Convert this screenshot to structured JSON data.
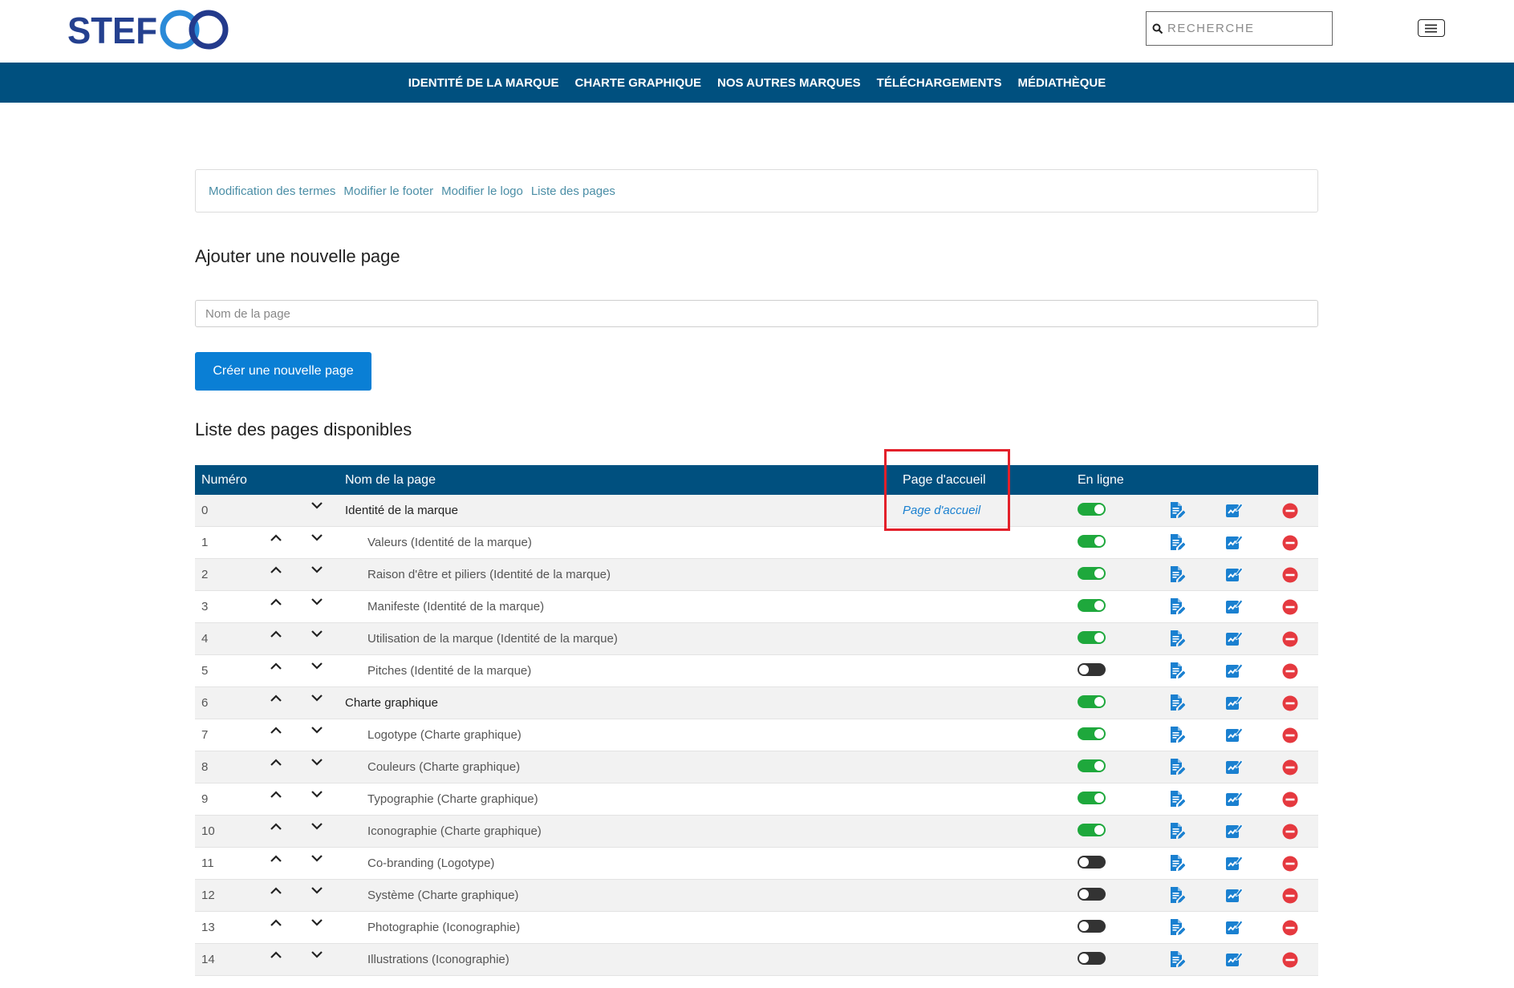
{
  "header": {
    "logo_text": "STEF",
    "search_placeholder": "RECHERCHE",
    "search_value": ""
  },
  "nav": {
    "items": [
      "IDENTITÉ DE LA MARQUE",
      "CHARTE GRAPHIQUE",
      "NOS AUTRES MARQUES",
      "TÉLÉCHARGEMENTS",
      "MÉDIATHÈQUE"
    ]
  },
  "admin_links": [
    "Modification des termes",
    "Modifier le footer",
    "Modifier le logo",
    "Liste des pages"
  ],
  "new_page": {
    "title": "Ajouter une nouvelle page",
    "name_placeholder": "Nom de la page",
    "name_value": "",
    "create_button_label": "Créer une nouvelle page"
  },
  "pages_list": {
    "title": "Liste des pages disponibles",
    "columns": {
      "number": "Numéro",
      "name": "Nom de la page",
      "homepage": "Page d'accueil",
      "online": "En ligne"
    },
    "rows": [
      {
        "number": "0",
        "name": "Identité de la marque",
        "depth": 0,
        "homepage_label": "Page d'accueil",
        "online": true,
        "can_move_up": false,
        "can_move_down": true
      },
      {
        "number": "1",
        "name": "Valeurs (Identité de la marque)",
        "depth": 1,
        "online": true,
        "can_move_up": true,
        "can_move_down": true
      },
      {
        "number": "2",
        "name": "Raison d'être et piliers (Identité de la marque)",
        "depth": 1,
        "online": true,
        "can_move_up": true,
        "can_move_down": true
      },
      {
        "number": "3",
        "name": "Manifeste (Identité de la marque)",
        "depth": 1,
        "online": true,
        "can_move_up": true,
        "can_move_down": true
      },
      {
        "number": "4",
        "name": "Utilisation de la marque (Identité de la marque)",
        "depth": 1,
        "online": true,
        "can_move_up": true,
        "can_move_down": true
      },
      {
        "number": "5",
        "name": "Pitches (Identité de la marque)",
        "depth": 1,
        "online": false,
        "can_move_up": true,
        "can_move_down": true
      },
      {
        "number": "6",
        "name": "Charte graphique",
        "depth": 0,
        "online": true,
        "can_move_up": true,
        "can_move_down": true
      },
      {
        "number": "7",
        "name": "Logotype (Charte graphique)",
        "depth": 1,
        "online": true,
        "can_move_up": true,
        "can_move_down": true
      },
      {
        "number": "8",
        "name": "Couleurs (Charte graphique)",
        "depth": 1,
        "online": true,
        "can_move_up": true,
        "can_move_down": true
      },
      {
        "number": "9",
        "name": "Typographie (Charte graphique)",
        "depth": 1,
        "online": true,
        "can_move_up": true,
        "can_move_down": true
      },
      {
        "number": "10",
        "name": "Iconographie (Charte graphique)",
        "depth": 1,
        "online": true,
        "can_move_up": true,
        "can_move_down": true
      },
      {
        "number": "11",
        "name": "Co-branding (Logotype)",
        "depth": 1,
        "online": false,
        "can_move_up": true,
        "can_move_down": true
      },
      {
        "number": "12",
        "name": "Système (Charte graphique)",
        "depth": 1,
        "online": false,
        "can_move_up": true,
        "can_move_down": true
      },
      {
        "number": "13",
        "name": "Photographie (Iconographie)",
        "depth": 1,
        "online": false,
        "can_move_up": true,
        "can_move_down": true
      },
      {
        "number": "14",
        "name": "Illustrations (Iconographie)",
        "depth": 1,
        "online": false,
        "can_move_up": true,
        "can_move_down": true
      }
    ]
  },
  "colors": {
    "nav_bg": "#00507f",
    "link": "#4b8ea6",
    "button_bg": "#0a7fd5",
    "toggle_on": "#1ea83c",
    "toggle_off": "#333333",
    "delete": "#e5393f",
    "action_icon": "#1a80d0",
    "highlight": "#e3202a"
  },
  "icons": {
    "logo": "stef-logo-icon",
    "search": "search-icon",
    "menu": "hamburger-icon",
    "move_up": "chevron-up-icon",
    "move_down": "chevron-down-icon",
    "edit_page": "edit-document-icon",
    "edit_content": "edit-content-icon",
    "delete": "delete-icon"
  }
}
